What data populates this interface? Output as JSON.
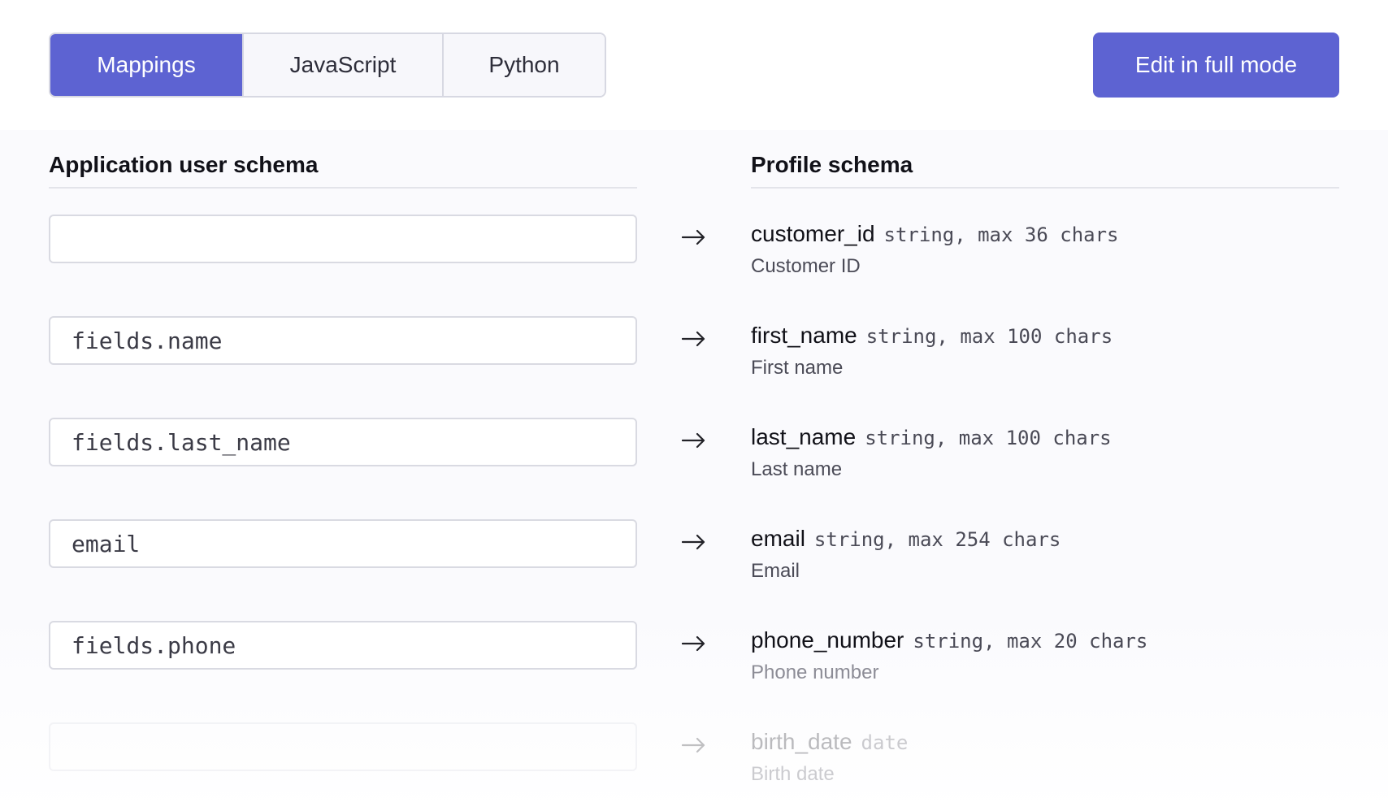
{
  "tabs": [
    {
      "label": "Mappings",
      "active": true
    },
    {
      "label": "JavaScript",
      "active": false
    },
    {
      "label": "Python",
      "active": false
    }
  ],
  "edit_button_label": "Edit in full mode",
  "columns": {
    "left_header": "Application user schema",
    "right_header": "Profile schema"
  },
  "mappings": [
    {
      "source": "",
      "target_name": "customer_id",
      "target_type": "string, max 36 chars",
      "target_label": "Customer ID"
    },
    {
      "source": "fields.name",
      "target_name": "first_name",
      "target_type": "string, max 100 chars",
      "target_label": "First name"
    },
    {
      "source": "fields.last_name",
      "target_name": "last_name",
      "target_type": "string, max 100 chars",
      "target_label": "Last name"
    },
    {
      "source": "email",
      "target_name": "email",
      "target_type": "string, max 254 chars",
      "target_label": "Email"
    },
    {
      "source": "fields.phone",
      "target_name": "phone_number",
      "target_type": "string, max 20 chars",
      "target_label": "Phone number"
    },
    {
      "source": "",
      "target_name": "birth_date",
      "target_type": "date",
      "target_label": "Birth date"
    }
  ],
  "icons": {
    "arrow": "arrow-right-icon"
  },
  "colors": {
    "accent": "#5d63d2",
    "accent_text": "#ffffff"
  }
}
